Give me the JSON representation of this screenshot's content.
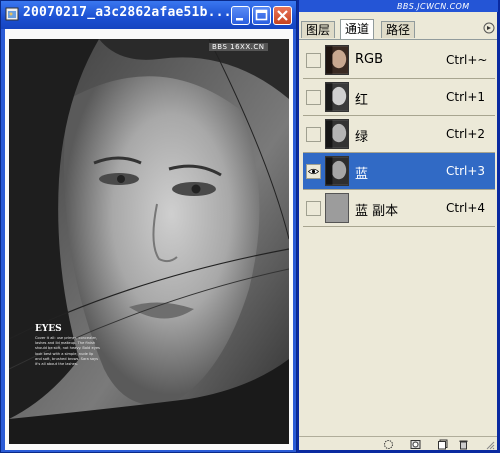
{
  "document_window": {
    "title": "20070217_a3c2862afae51b...",
    "photo_watermark": "BBS 16XX.CN",
    "eyes_heading": "EYES",
    "eyes_text": "Cover it all: use primer, concealer, lashes and lid makeup. The finish should be soft, not heavy. Bold eyes look best with a simple, nude lip and soft, brushed brows. Sara says it's all about the lashes."
  },
  "channels_panel": {
    "watermark": "BBS.JCWCN.COM",
    "tabs": [
      "图层",
      "通道",
      "路径"
    ],
    "active_tab": 1,
    "rows": [
      {
        "name": "RGB",
        "shortcut": "Ctrl+~",
        "visible": false,
        "selected": false,
        "thumb": "color"
      },
      {
        "name": "红",
        "shortcut": "Ctrl+1",
        "visible": false,
        "selected": false,
        "thumb": "gray"
      },
      {
        "name": "绿",
        "shortcut": "Ctrl+2",
        "visible": false,
        "selected": false,
        "thumb": "gray"
      },
      {
        "name": "蓝",
        "shortcut": "Ctrl+3",
        "visible": true,
        "selected": true,
        "thumb": "gray"
      },
      {
        "name": "蓝 副本",
        "shortcut": "Ctrl+4",
        "visible": false,
        "selected": false,
        "thumb": "blank"
      }
    ],
    "bottom_icons": [
      "load-selection-icon",
      "save-selection-icon",
      "new-channel-icon",
      "delete-channel-icon"
    ]
  },
  "colors": {
    "title_bar": "#1b4fd1",
    "selected_row": "#316ac5",
    "panel_bg": "#ece9d8",
    "close_button": "#c6421f"
  }
}
